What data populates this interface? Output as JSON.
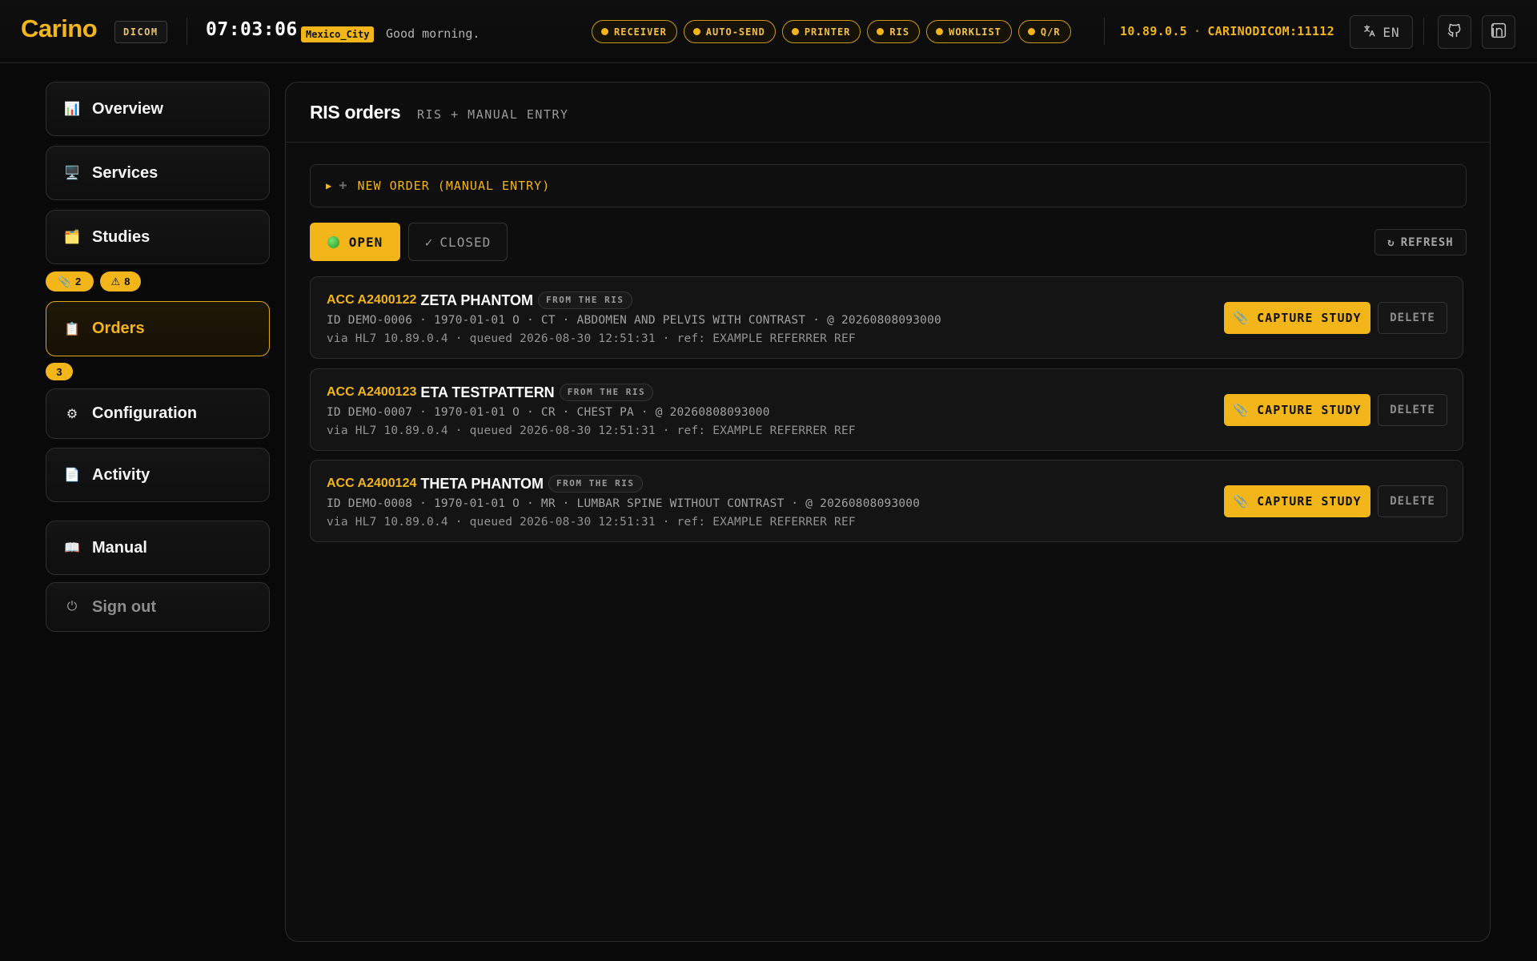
{
  "header": {
    "brand": "Carino",
    "brand_badge": "DICOM",
    "clock": "07:03:06",
    "timezone": "Mexico_City",
    "greeting": "Good morning.",
    "services": [
      {
        "label": "RECEIVER",
        "status_color": "#f2b51a"
      },
      {
        "label": "AUTO-SEND",
        "status_color": "#f2b51a"
      },
      {
        "label": "PRINTER",
        "status_color": "#f2b51a"
      },
      {
        "label": "RIS",
        "status_color": "#f2b51a"
      },
      {
        "label": "WORKLIST",
        "status_color": "#f2b51a"
      },
      {
        "label": "Q/R",
        "status_color": "#f2b51a"
      }
    ],
    "host_ip": "10.89.0.5",
    "host_separator": "·",
    "ae_title": "CARINODICOM:11112",
    "language": "EN",
    "language_icon": "translate-icon",
    "github_icon": "github-icon",
    "linkedin_icon": "linkedin-icon"
  },
  "sidebar": {
    "items": [
      {
        "label": "Overview",
        "icon": "📊",
        "icon_name": "chart-icon"
      },
      {
        "label": "Services",
        "icon": "🖥️",
        "icon_name": "monitor-icon"
      },
      {
        "label": "Studies",
        "icon": "🗂️",
        "icon_name": "folder-icon"
      },
      {
        "label": "Orders",
        "icon": "📋",
        "icon_name": "clipboard-icon",
        "active": true
      },
      {
        "label": "Configuration",
        "icon": "⚙",
        "icon_name": "gear-icon"
      },
      {
        "label": "Activity",
        "icon": "📄",
        "icon_name": "document-icon"
      },
      {
        "label": "Manual",
        "icon": "📖",
        "icon_name": "book-icon"
      },
      {
        "label": "Sign out",
        "icon": "⏻",
        "icon_name": "sign-out-icon"
      }
    ],
    "studies_badges": [
      {
        "icon": "📎",
        "count": "2"
      },
      {
        "icon": "⚠",
        "count": "8"
      }
    ],
    "orders_badge": "3"
  },
  "main": {
    "title": "RIS orders",
    "subtitle": "RIS + MANUAL ENTRY",
    "new_order_label": "NEW ORDER (MANUAL ENTRY)",
    "tabs": {
      "open": "OPEN",
      "closed": "CLOSED"
    },
    "refresh_label": "REFRESH",
    "capture_label": "CAPTURE STUDY",
    "delete_label": "DELETE",
    "orders": [
      {
        "acc": "ACC A2400122",
        "patient": "ZETA PHANTOM",
        "source": "FROM THE RIS",
        "details": "ID DEMO-0006 · 1970-01-01 O · CT · ABDOMEN AND PELVIS WITH CONTRAST · @ 20260808093000",
        "meta": "via HL7 10.89.0.4 · queued 2026-08-30 12:51:31 · ref: EXAMPLE REFERRER REF"
      },
      {
        "acc": "ACC A2400123",
        "patient": "ETA TESTPATTERN",
        "source": "FROM THE RIS",
        "details": "ID DEMO-0007 · 1970-01-01 O · CR · CHEST PA · @ 20260808093000",
        "meta": "via HL7 10.89.0.4 · queued 2026-08-30 12:51:31 · ref: EXAMPLE REFERRER REF"
      },
      {
        "acc": "ACC A2400124",
        "patient": "THETA PHANTOM",
        "source": "FROM THE RIS",
        "details": "ID DEMO-0008 · 1970-01-01 O · MR · LUMBAR SPINE WITHOUT CONTRAST · @ 20260808093000",
        "meta": "via HL7 10.89.0.4 · queued 2026-08-30 12:51:31 · ref: EXAMPLE REFERRER REF"
      }
    ]
  },
  "colors": {
    "accent": "#f2b51a",
    "background": "#090909",
    "open_status": "#3fbf3a"
  }
}
